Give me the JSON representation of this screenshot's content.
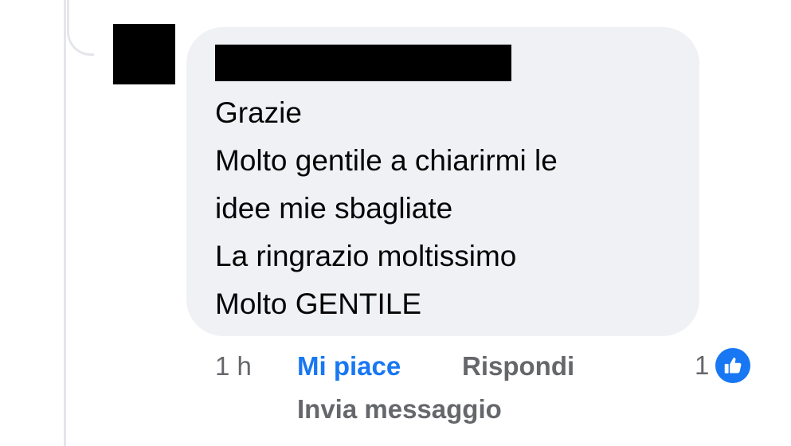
{
  "comment": {
    "author_name_redacted": true,
    "avatar_redacted": true,
    "lines": [
      "Grazie",
      "Molto gentile a chiarirmi le",
      "idee mie sbagliate",
      "La ringrazio moltissimo",
      "Molto GENTILE"
    ]
  },
  "actions": {
    "timestamp": "1 h",
    "like_label": "Mi piace",
    "reply_label": "Rispondi",
    "message_label": "Invia messaggio"
  },
  "reactions": {
    "count": "1",
    "icon": "thumbs-up-icon"
  },
  "colors": {
    "bubble": "#f0f1f5",
    "text": "#050505",
    "secondary_text": "#65676b",
    "accent": "#1877f2",
    "thread_line": "#e4e6eb"
  }
}
